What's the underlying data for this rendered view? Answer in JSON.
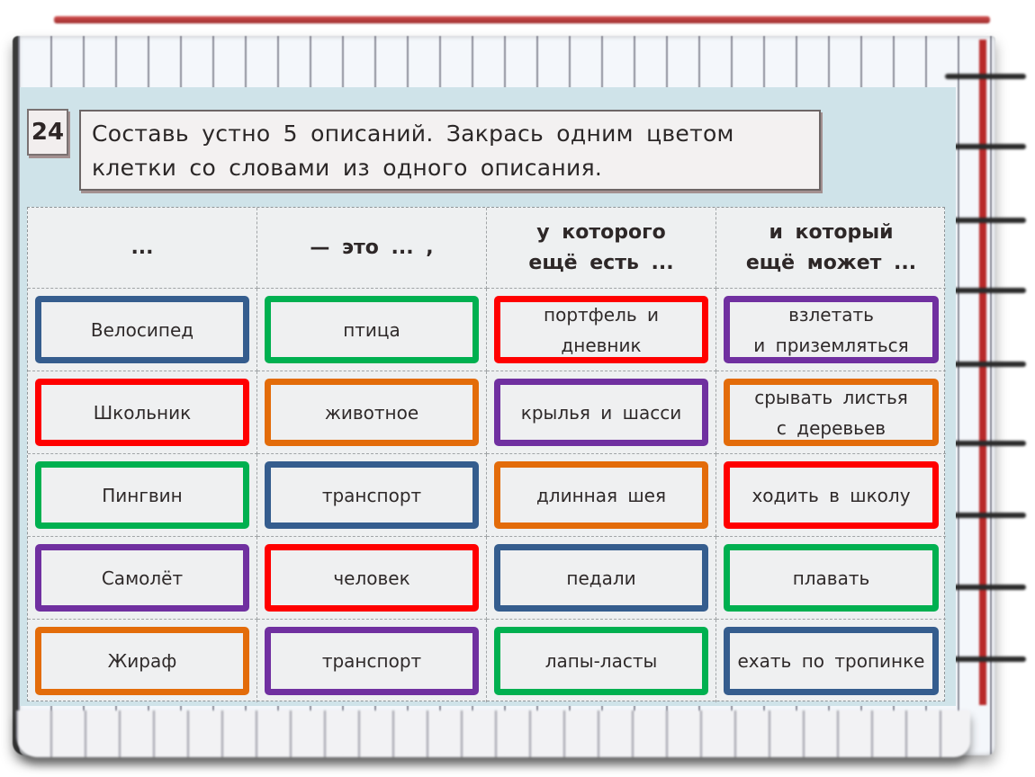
{
  "task": {
    "number": "24",
    "instruction_line1": "Составь устно 5 описаний. Закрась одним цветом",
    "instruction_line2": "клетки со словами из одного описания."
  },
  "table": {
    "headers": [
      "...",
      "— это ... ,",
      "у которого\nещё есть ...",
      "и который\nещё может ..."
    ],
    "colors": {
      "blue": "#355d8e",
      "green": "#00b050",
      "red": "#ff0000",
      "purple": "#7030a0",
      "orange": "#e36c0a"
    },
    "rows": [
      [
        {
          "text": "Велосипед",
          "color": "blue"
        },
        {
          "text": "птица",
          "color": "green"
        },
        {
          "text": "портфель и\nдневник",
          "color": "red"
        },
        {
          "text": "взлетать\nи приземляться",
          "color": "purple"
        }
      ],
      [
        {
          "text": "Школьник",
          "color": "red"
        },
        {
          "text": "животное",
          "color": "orange"
        },
        {
          "text": "крылья и шасси",
          "color": "purple"
        },
        {
          "text": "срывать листья\nс деревьев",
          "color": "orange"
        }
      ],
      [
        {
          "text": "Пингвин",
          "color": "green"
        },
        {
          "text": "транспорт",
          "color": "blue"
        },
        {
          "text": "длинная шея",
          "color": "orange"
        },
        {
          "text": "ходить в школу",
          "color": "red"
        }
      ],
      [
        {
          "text": "Самолёт",
          "color": "purple"
        },
        {
          "text": "человек",
          "color": "red"
        },
        {
          "text": "педали",
          "color": "blue"
        },
        {
          "text": "плавать",
          "color": "green"
        }
      ],
      [
        {
          "text": "Жираф",
          "color": "orange"
        },
        {
          "text": "транспорт",
          "color": "purple"
        },
        {
          "text": "лапы-ласты",
          "color": "green"
        },
        {
          "text": "ехать по тропинке",
          "color": "blue"
        }
      ]
    ]
  }
}
